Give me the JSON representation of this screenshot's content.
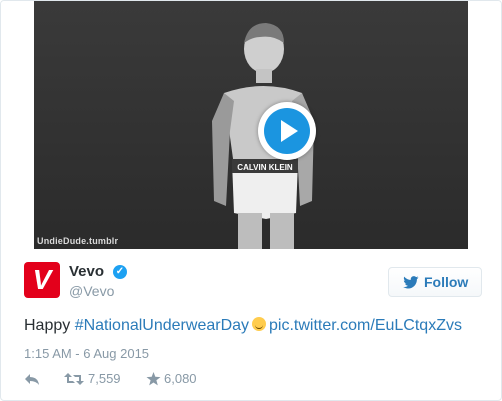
{
  "media": {
    "watermark": "UndieDude.tumblr",
    "waistband_text": "CALVIN KLEIN"
  },
  "tweet": {
    "author_name": "Vevo",
    "author_handle": "@Vevo",
    "verified_glyph": "✓",
    "avatar_letter": "V",
    "follow_label": "Follow",
    "text_prefix": "Happy ",
    "hashtag": "#NationalUnderwearDay",
    "pic_link": "pic.twitter.com/EuLCtqxZvs",
    "timestamp": "1:15 AM - 6 Aug 2015",
    "retweet_count": "7,559",
    "like_count": "6,080"
  },
  "colors": {
    "brand_red": "#e3001b",
    "link_blue": "#2b7bb9",
    "play_blue": "#1b95e0",
    "meta_gray": "#8899a6"
  },
  "icons": [
    "play-icon",
    "verified-badge-icon",
    "twitter-bird-icon",
    "reply-icon",
    "retweet-icon",
    "like-star-icon",
    "smiling-emoji-icon"
  ]
}
